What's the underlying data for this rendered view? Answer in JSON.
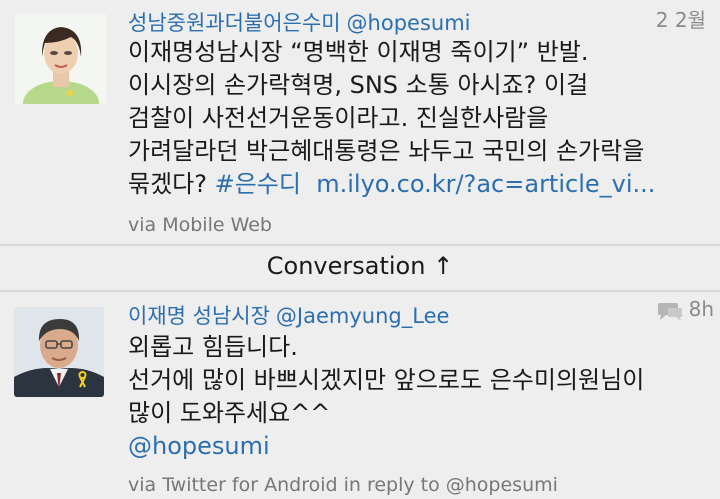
{
  "tweets": [
    {
      "author_name": "성남중원과더불어은수미",
      "author_handle": "@hopesumi",
      "time": "2 2월",
      "body_lines": [
        "이재명성남시장 “명백한 이재명 죽이기” 반발.",
        "이시장의 손가락혁명, SNS 소통 아시죠? 이걸",
        "검찰이 사전선거운동이라고. 진실한사람을",
        "가려달라던 박근혜대통령은 놔두고 국민의 손가락을"
      ],
      "last_line_text": "묶겠다? ",
      "hashtag": "#은수디",
      "link": "m.ilyo.co.kr/?ac=article_vi...",
      "via": "via Mobile Web"
    },
    {
      "author_name": "이재명 성남시장",
      "author_handle": "@Jaemyung_Lee",
      "time": "8h",
      "body_lines": [
        "외롭고 힘듭니다.",
        "선거에 많이 바쁘시겠지만 앞으로도 은수미의원님이",
        "많이 도와주세요^^"
      ],
      "mention": "@hopesumi",
      "via": "via Twitter for Android in reply to @hopesumi"
    }
  ],
  "conversation_label": "Conversation ↑",
  "colors": {
    "background": "#eeeeee",
    "link": "#2b6fb0",
    "meta": "#777777",
    "divider": "#d8d8d8"
  },
  "icons": {
    "reply": "speech-bubble-reply-icon"
  }
}
